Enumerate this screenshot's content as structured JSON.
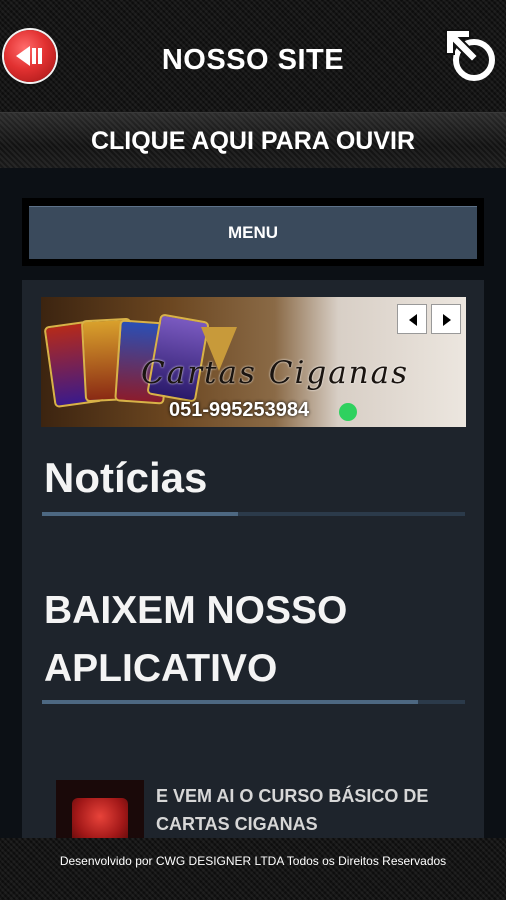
{
  "header": {
    "title": "NOSSO SITE",
    "back_icon": "rewind-icon",
    "share_icon": "share-icon"
  },
  "listen_bar": {
    "label": "CLIQUE AQUI PARA OUVIR"
  },
  "menu": {
    "label": "MENU"
  },
  "banner": {
    "title": "Cartas Ciganas",
    "phone": "051-995253984",
    "prev_icon": "arrow-left-icon",
    "next_icon": "arrow-right-icon"
  },
  "sections": {
    "news_heading": "Notícias",
    "download_heading": "BAIXEM NOSSO APLICATIVO"
  },
  "news_items": [
    {
      "title": "E VEM AI O CURSO BÁSICO DE CARTAS CIGANAS"
    }
  ],
  "footer": {
    "text": "Desenvolvido por CWG DESIGNER LTDA Todos os Direitos Reservados"
  },
  "colors": {
    "menu_button": "#3a4a5c",
    "panel_bg": "#1e242c",
    "accent_red": "#e23131"
  }
}
